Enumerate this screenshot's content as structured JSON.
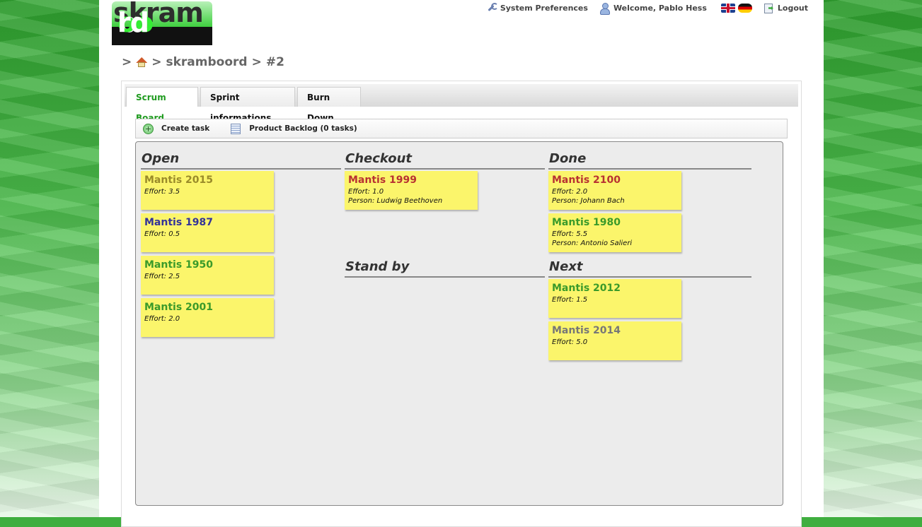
{
  "logo": {
    "top": "skram",
    "bottom_a": "b",
    "bottom_b": "oo",
    "bottom_c": "rd"
  },
  "topmenu": {
    "preferences": "System Preferences",
    "welcome": "Welcome, Pablo Hess",
    "logout": "Logout"
  },
  "breadcrumb": {
    "sep1": ">",
    "sep2": ">",
    "project": "skramboord",
    "sep3": ">",
    "sprint": "#2"
  },
  "tabs": [
    {
      "label": "Scrum Board"
    },
    {
      "label": "Sprint informations"
    },
    {
      "label": "Burn Down"
    }
  ],
  "toolbar": {
    "create_task": "Create task",
    "product_backlog": "Product Backlog (0 tasks)"
  },
  "columns": {
    "open": "Open",
    "checkout": "Checkout",
    "done": "Done",
    "standby": "Stand by",
    "next": "Next"
  },
  "cards": {
    "open": [
      {
        "title": "Mantis 2015",
        "effort": "Effort: 3.5",
        "color": "#9a8b2a"
      },
      {
        "title": "Mantis 1987",
        "effort": "Effort: 0.5",
        "color": "#333399"
      },
      {
        "title": "Mantis 1950",
        "effort": "Effort: 2.5",
        "color": "#3a9a2a"
      },
      {
        "title": "Mantis 2001",
        "effort": "Effort: 2.0",
        "color": "#3a9a2a"
      }
    ],
    "checkout": [
      {
        "title": "Mantis 1999",
        "effort": "Effort: 1.0",
        "person": "Person: Ludwig Beethoven",
        "color": "#b83232"
      }
    ],
    "done": [
      {
        "title": "Mantis 2100",
        "effort": "Effort: 2.0",
        "person": "Person: Johann Bach",
        "color": "#b83232"
      },
      {
        "title": "Mantis 1980",
        "effort": "Effort: 5.5",
        "person": "Person: Antonio Salieri",
        "color": "#3a9a2a"
      }
    ],
    "next": [
      {
        "title": "Mantis 2012",
        "effort": "Effort: 1.5",
        "color": "#3a9a2a"
      },
      {
        "title": "Mantis 2014",
        "effort": "Effort: 5.0",
        "color": "#777777"
      }
    ]
  },
  "colors": {
    "accent": "#1f9b1f",
    "card": "#fbf56b",
    "board": "#ececec"
  }
}
